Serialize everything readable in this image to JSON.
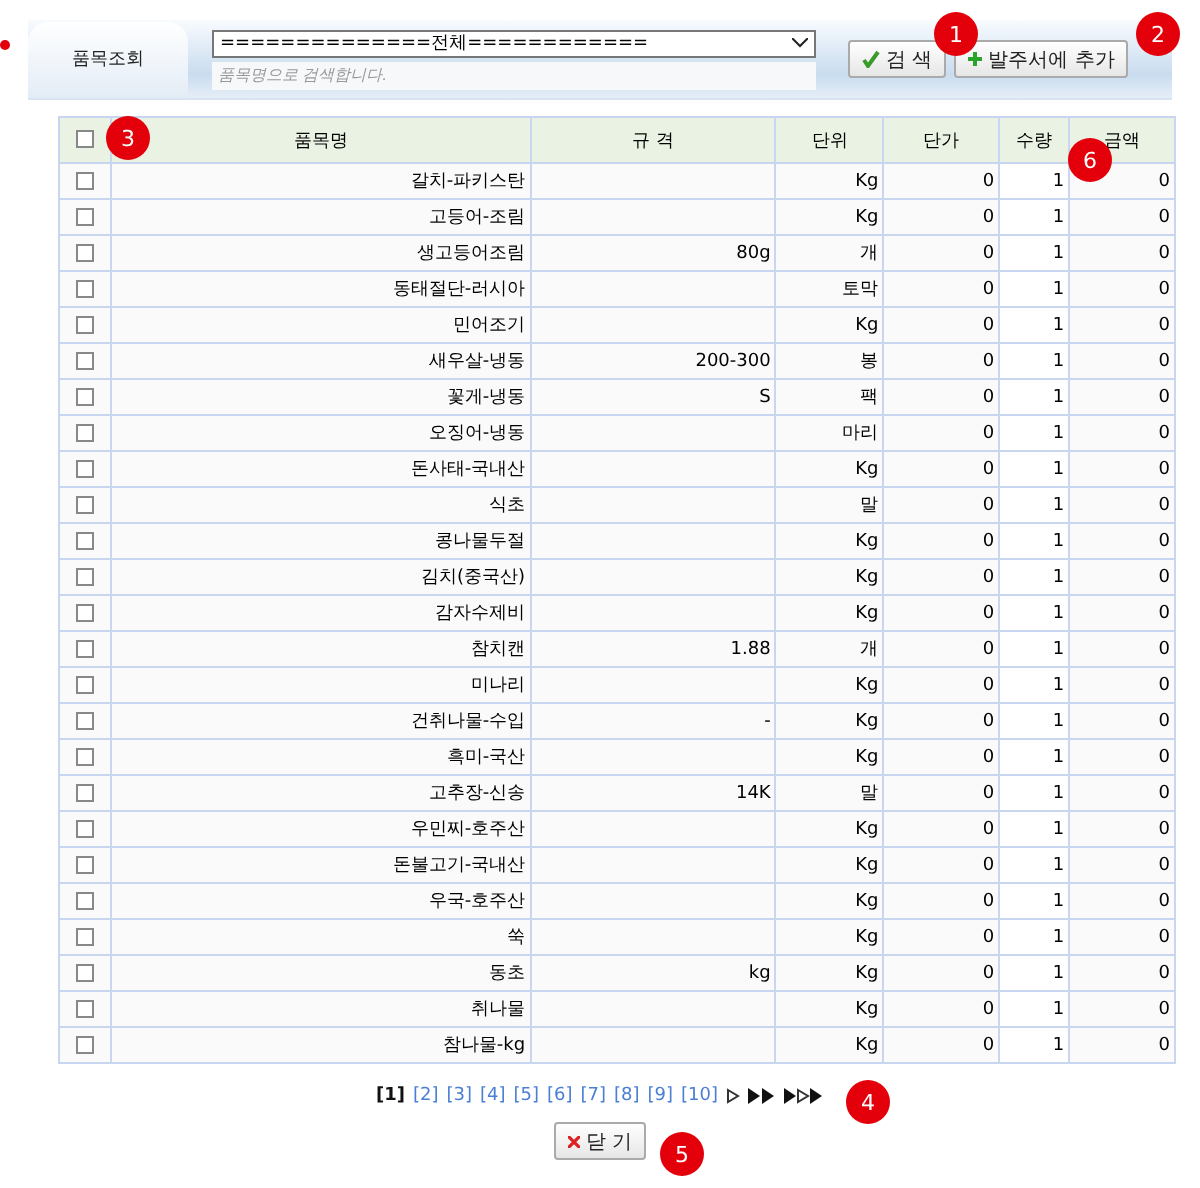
{
  "header": {
    "tab": "품목조회",
    "category": "==============전체============",
    "search": {
      "placeholder": "품목명으로 검색합니다."
    },
    "buttons": [
      {
        "kind": "search",
        "label": "검 색"
      },
      {
        "kind": "add",
        "label": "발주서에 추가"
      }
    ]
  },
  "table": {
    "select_all": {
      "checked": false
    },
    "columns": [
      "품목명",
      "규 격",
      "단위",
      "단가",
      "수량",
      "금액"
    ],
    "rows": [
      {
        "checked": false,
        "name": "갈치-파키스탄",
        "spec": "",
        "unit": "Kg",
        "price": "0",
        "qty": "1",
        "amount": "0"
      },
      {
        "checked": false,
        "name": "고등어-조림",
        "spec": "",
        "unit": "Kg",
        "price": "0",
        "qty": "1",
        "amount": "0"
      },
      {
        "checked": false,
        "name": "생고등어조림",
        "spec": "80g",
        "unit": "개",
        "price": "0",
        "qty": "1",
        "amount": "0"
      },
      {
        "checked": false,
        "name": "동태절단-러시아",
        "spec": "",
        "unit": "토막",
        "price": "0",
        "qty": "1",
        "amount": "0"
      },
      {
        "checked": false,
        "name": "민어조기",
        "spec": "",
        "unit": "Kg",
        "price": "0",
        "qty": "1",
        "amount": "0"
      },
      {
        "checked": false,
        "name": "새우살-냉동",
        "spec": "200-300",
        "unit": "봉",
        "price": "0",
        "qty": "1",
        "amount": "0"
      },
      {
        "checked": false,
        "name": "꽃게-냉동",
        "spec": "S",
        "unit": "팩",
        "price": "0",
        "qty": "1",
        "amount": "0"
      },
      {
        "checked": false,
        "name": "오징어-냉동",
        "spec": "",
        "unit": "마리",
        "price": "0",
        "qty": "1",
        "amount": "0"
      },
      {
        "checked": false,
        "name": "돈사태-국내산",
        "spec": "",
        "unit": "Kg",
        "price": "0",
        "qty": "1",
        "amount": "0"
      },
      {
        "checked": false,
        "name": "식초",
        "spec": "",
        "unit": "말",
        "price": "0",
        "qty": "1",
        "amount": "0"
      },
      {
        "checked": false,
        "name": "콩나물두절",
        "spec": "",
        "unit": "Kg",
        "price": "0",
        "qty": "1",
        "amount": "0"
      },
      {
        "checked": false,
        "name": "김치(중국산)",
        "spec": "",
        "unit": "Kg",
        "price": "0",
        "qty": "1",
        "amount": "0"
      },
      {
        "checked": false,
        "name": "감자수제비",
        "spec": "",
        "unit": "Kg",
        "price": "0",
        "qty": "1",
        "amount": "0"
      },
      {
        "checked": false,
        "name": "참치캔",
        "spec": "1.88",
        "unit": "개",
        "price": "0",
        "qty": "1",
        "amount": "0"
      },
      {
        "checked": false,
        "name": "미나리",
        "spec": "",
        "unit": "Kg",
        "price": "0",
        "qty": "1",
        "amount": "0"
      },
      {
        "checked": false,
        "name": "건취나물-수입",
        "spec": "-",
        "unit": "Kg",
        "price": "0",
        "qty": "1",
        "amount": "0"
      },
      {
        "checked": false,
        "name": "흑미-국산",
        "spec": "",
        "unit": "Kg",
        "price": "0",
        "qty": "1",
        "amount": "0"
      },
      {
        "checked": false,
        "name": "고추장-신송",
        "spec": "14K",
        "unit": "말",
        "price": "0",
        "qty": "1",
        "amount": "0"
      },
      {
        "checked": false,
        "name": "우민찌-호주산",
        "spec": "",
        "unit": "Kg",
        "price": "0",
        "qty": "1",
        "amount": "0"
      },
      {
        "checked": false,
        "name": "돈불고기-국내산",
        "spec": "",
        "unit": "Kg",
        "price": "0",
        "qty": "1",
        "amount": "0"
      },
      {
        "checked": false,
        "name": "우국-호주산",
        "spec": "",
        "unit": "Kg",
        "price": "0",
        "qty": "1",
        "amount": "0"
      },
      {
        "checked": false,
        "name": "쑥",
        "spec": "",
        "unit": "Kg",
        "price": "0",
        "qty": "1",
        "amount": "0"
      },
      {
        "checked": false,
        "name": "동초",
        "spec": "kg",
        "unit": "Kg",
        "price": "0",
        "qty": "1",
        "amount": "0"
      },
      {
        "checked": false,
        "name": "취나물",
        "spec": "",
        "unit": "Kg",
        "price": "0",
        "qty": "1",
        "amount": "0"
      },
      {
        "checked": false,
        "name": "참나물-kg",
        "spec": "",
        "unit": "Kg",
        "price": "0",
        "qty": "1",
        "amount": "0"
      }
    ]
  },
  "pagination": {
    "pages": [
      {
        "label": "[1]",
        "selected": true
      },
      {
        "label": "[2]",
        "selected": false
      },
      {
        "label": "[3]",
        "selected": false
      },
      {
        "label": "[4]",
        "selected": false
      },
      {
        "label": "[5]",
        "selected": false
      },
      {
        "label": "[6]",
        "selected": false
      },
      {
        "label": "[7]",
        "selected": false
      },
      {
        "label": "[8]",
        "selected": false
      },
      {
        "label": "[9]",
        "selected": false
      },
      {
        "label": "[10]",
        "selected": false
      }
    ],
    "nav": [
      {
        "kind": "next"
      },
      {
        "kind": "next-block"
      },
      {
        "kind": "last"
      }
    ]
  },
  "close_button": {
    "label": "닫 기"
  },
  "callouts": [
    {
      "label": "1",
      "kind": "search"
    },
    {
      "label": "2",
      "kind": "add"
    },
    {
      "label": "3",
      "kind": "check"
    },
    {
      "label": "4",
      "kind": "paging"
    },
    {
      "label": "5",
      "kind": "close"
    },
    {
      "label": "6",
      "kind": "amount"
    }
  ]
}
